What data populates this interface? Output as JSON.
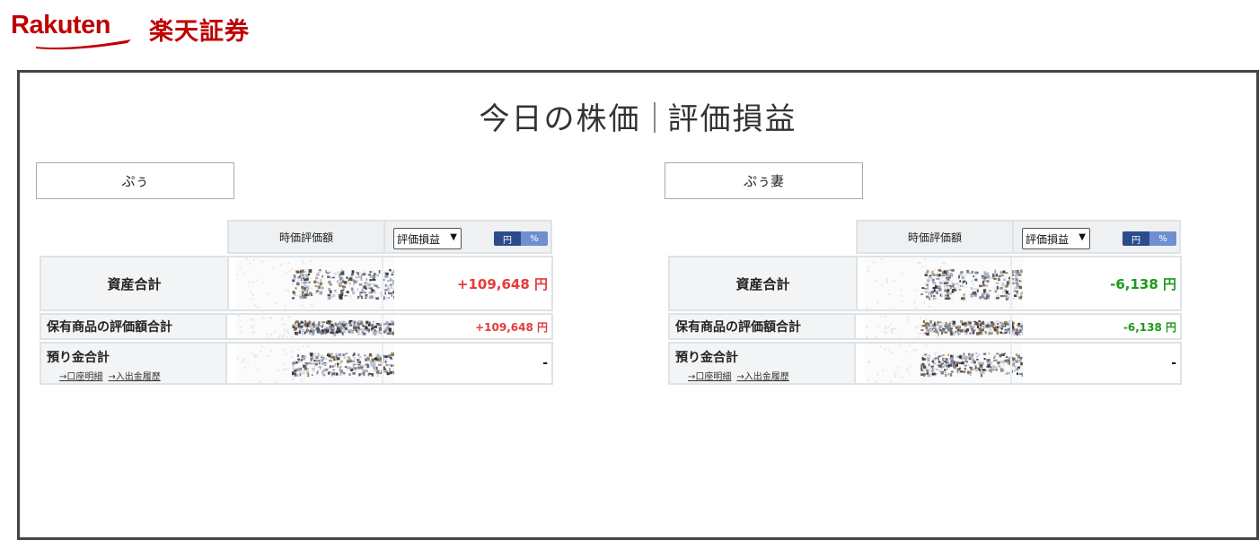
{
  "logo": {
    "latin": "Rakuten",
    "japanese": "楽天証券",
    "brand_color": "#bf0000"
  },
  "title": {
    "part1": "今日の株価",
    "part2": "評価損益"
  },
  "panels": [
    {
      "account_name": "ぷぅ",
      "header": {
        "column_label": "時価評価額",
        "select_value": "評価損益",
        "toggle_yen": "円",
        "toggle_pct": "%"
      },
      "rows": {
        "total_assets": {
          "label": "資産合計",
          "value": "+109,648 円",
          "color": "#e63a3a"
        },
        "holdings_total": {
          "label": "保有商品の評価額合計",
          "value": "+109,648 円",
          "color": "#e63a3a"
        },
        "deposit_total": {
          "label": "預り金合計",
          "value": "-",
          "link1": "→口座明細",
          "link2": "→入出金履歴"
        }
      }
    },
    {
      "account_name": "ぷぅ妻",
      "header": {
        "column_label": "時価評価額",
        "select_value": "評価損益",
        "toggle_yen": "円",
        "toggle_pct": "%"
      },
      "rows": {
        "total_assets": {
          "label": "資産合計",
          "value": "-6,138 円",
          "color": "#1a9a1a"
        },
        "holdings_total": {
          "label": "保有商品の評価額合計",
          "value": "-6,138 円",
          "color": "#1a9a1a"
        },
        "deposit_total": {
          "label": "預り金合計",
          "value": "-",
          "link1": "→口座明細",
          "link2": "→入出金履歴"
        }
      }
    }
  ]
}
